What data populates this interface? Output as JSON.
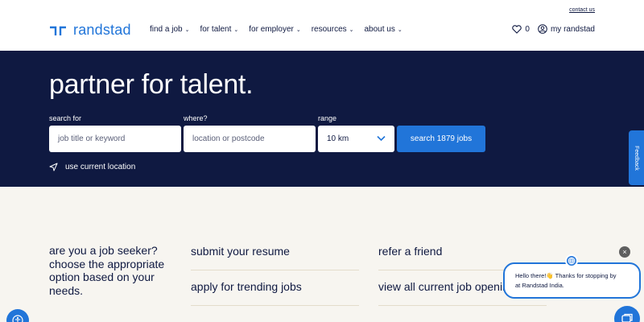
{
  "header": {
    "contact_link": "contact us",
    "logo_text": "randstad",
    "nav": [
      {
        "label": "find a job"
      },
      {
        "label": "for talent"
      },
      {
        "label": "for employer"
      },
      {
        "label": "resources"
      },
      {
        "label": "about us"
      }
    ],
    "favorites_count": "0",
    "account_label": "my randstad"
  },
  "hero": {
    "title": "partner for talent.",
    "search_label": "search for",
    "search_placeholder": "job title or keyword",
    "where_label": "where?",
    "where_placeholder": "location or postcode",
    "range_label": "range",
    "range_value": "10 km",
    "search_button": "search 1879 jobs",
    "use_location": "use current location"
  },
  "feedback_tab": "Feedback",
  "content": {
    "seeker_text": "are you a job seeker? choose the appropriate option based on your needs.",
    "options": [
      {
        "label": "submit your resume"
      },
      {
        "label": "refer a friend"
      },
      {
        "label": "apply for trending jobs"
      },
      {
        "label": "view all current job openings"
      }
    ]
  },
  "chat": {
    "close": "×",
    "line1": "Hello there!👋 Thanks for stopping by",
    "line2": "at Randstad India."
  },
  "colors": {
    "brand_blue": "#2175d9",
    "navy": "#0f1941",
    "page_bg": "#f7f5f0"
  }
}
